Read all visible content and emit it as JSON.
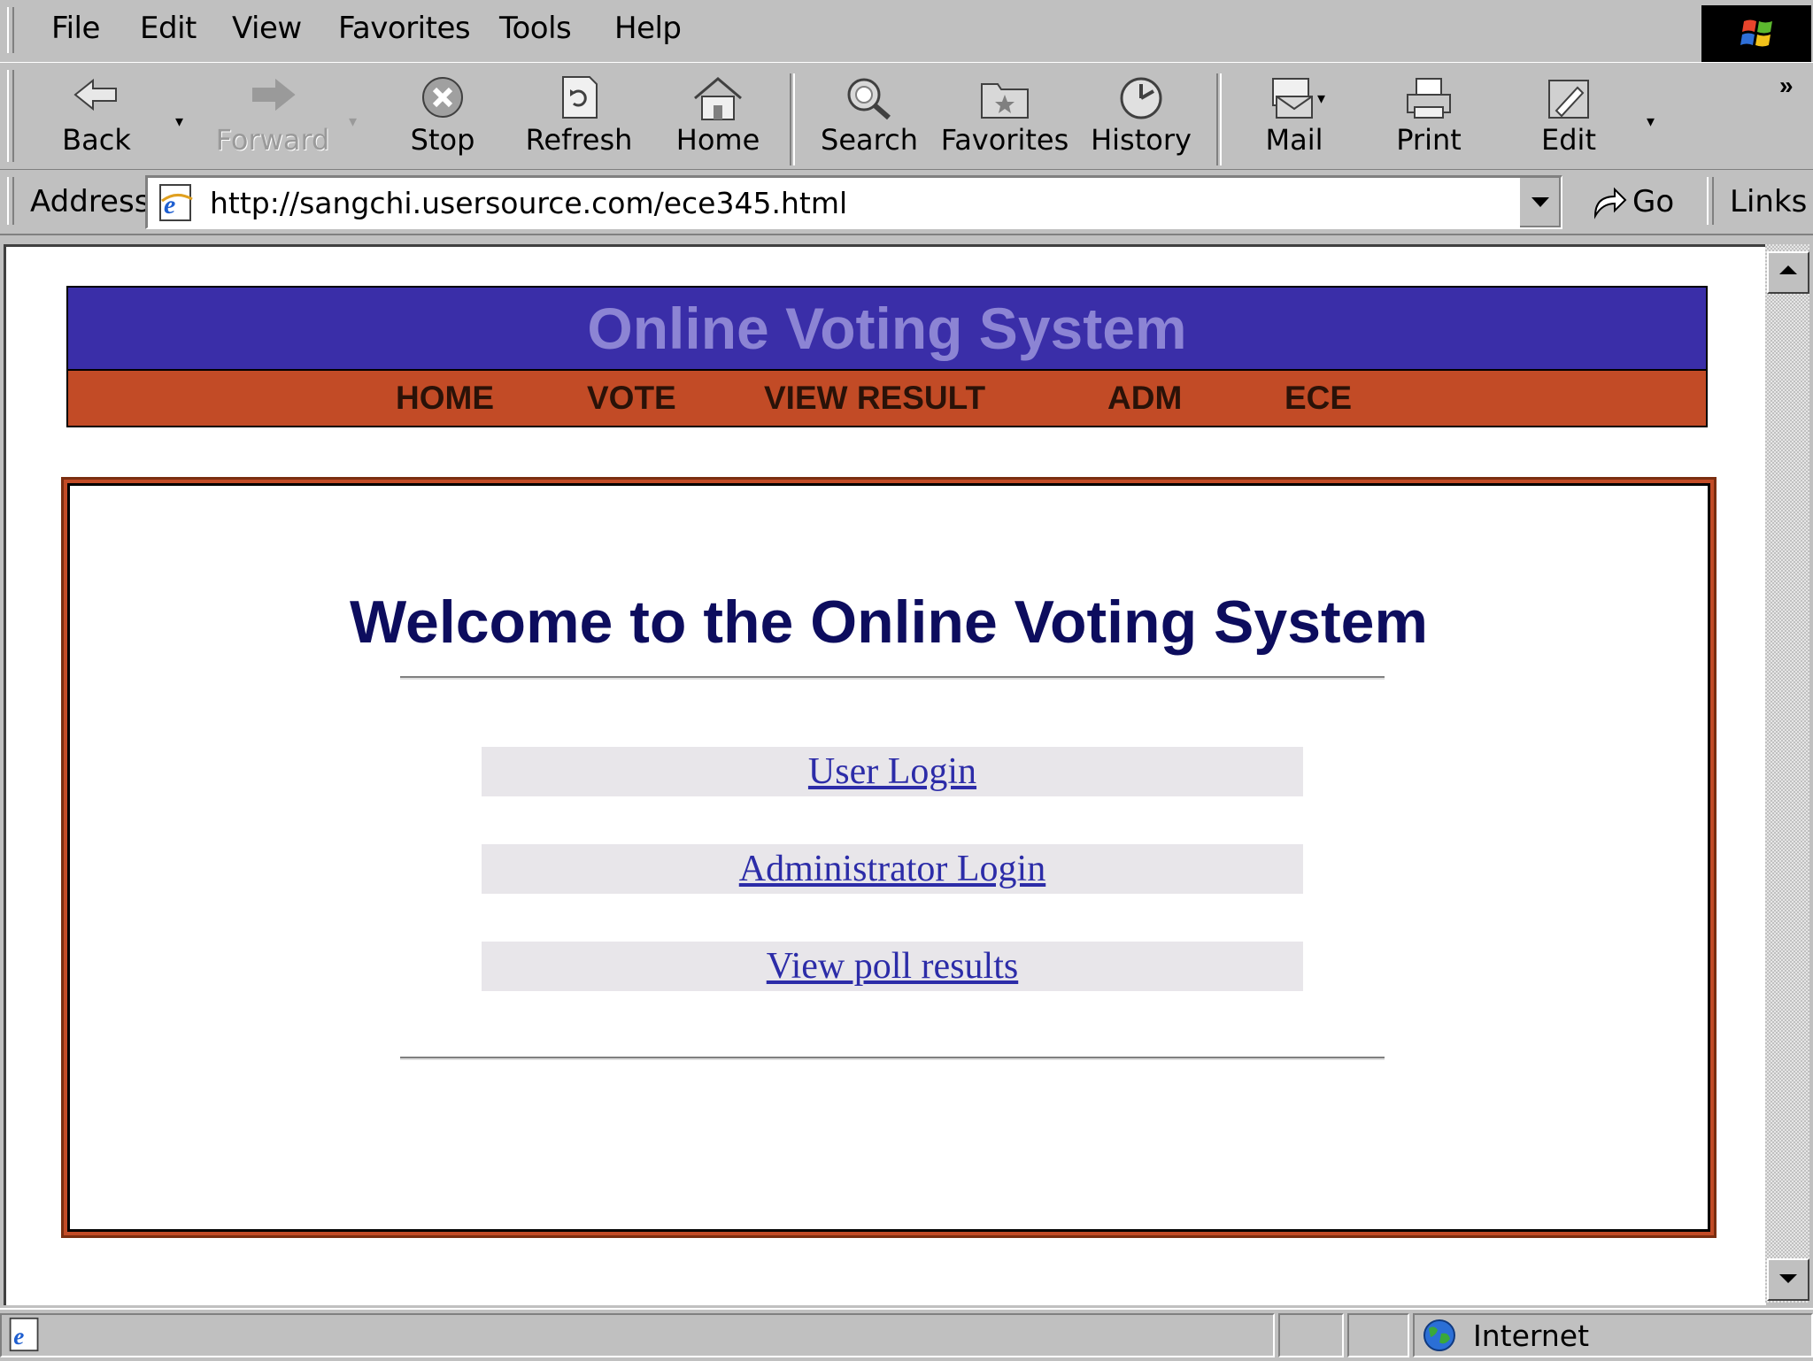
{
  "menu": {
    "items": [
      {
        "label": "File"
      },
      {
        "label": "Edit"
      },
      {
        "label": "View"
      },
      {
        "label": "Favorites"
      },
      {
        "label": "Tools"
      },
      {
        "label": "Help"
      }
    ]
  },
  "toolbar": {
    "back": "Back",
    "forward": "Forward",
    "stop": "Stop",
    "refresh": "Refresh",
    "home": "Home",
    "search": "Search",
    "favorites": "Favorites",
    "history": "History",
    "mail": "Mail",
    "print": "Print",
    "edit": "Edit",
    "more": "»"
  },
  "address": {
    "label": "Address",
    "url": "http://sangchi.usersource.com/ece345.html",
    "go": "Go",
    "links": "Links"
  },
  "page": {
    "banner_title": "Online Voting System",
    "nav": [
      "HOME",
      "VOTE",
      "VIEW RESULT",
      "ADM",
      "ECE"
    ],
    "welcome": "Welcome to the Online Voting System",
    "links": [
      "User Login",
      "Administrator Login",
      "View poll results"
    ]
  },
  "status": {
    "zone": "Internet"
  },
  "colors": {
    "banner_blue": "#3a2ea8",
    "banner_title": "#8c84d4",
    "nav_orange": "#c24b26",
    "heading_navy": "#0d0d5e",
    "link_blue": "#2c2ca8",
    "chrome_gray": "#c0c0c0"
  }
}
